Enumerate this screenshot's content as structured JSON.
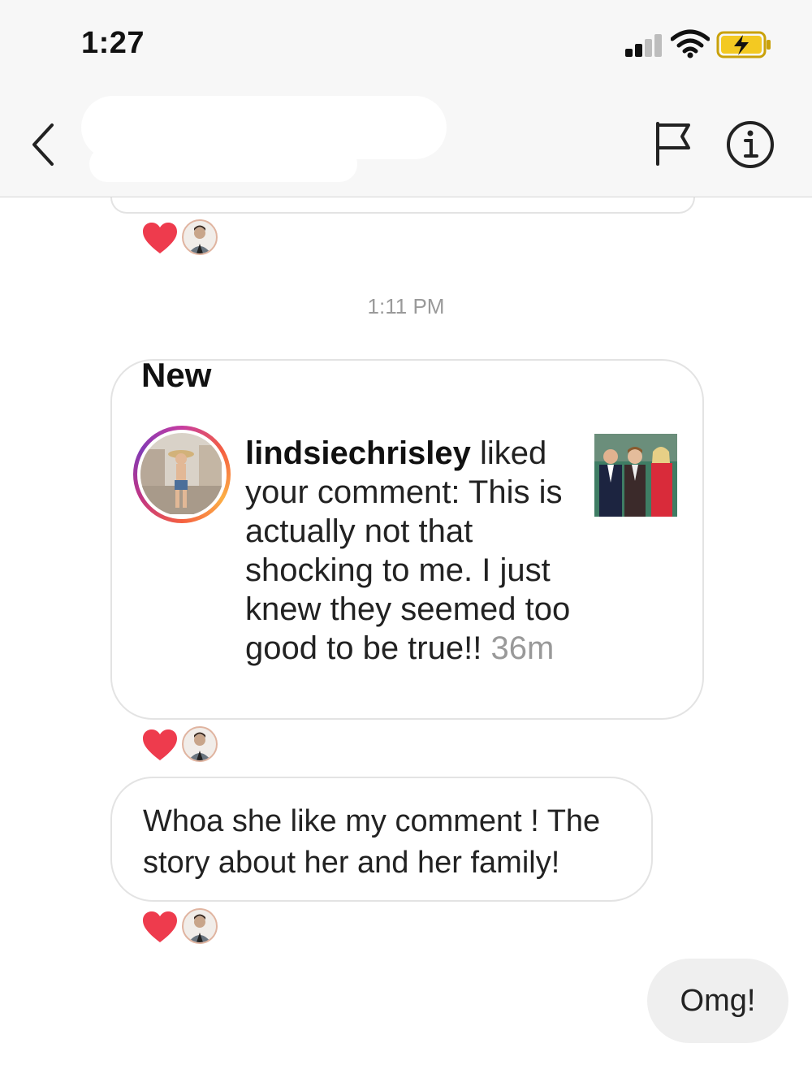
{
  "status_bar": {
    "time": "1:27",
    "signal_icon": "cellular-signal-icon",
    "wifi_icon": "wifi-icon",
    "battery_icon": "battery-charging-icon",
    "battery_color": "#f3c922"
  },
  "header": {
    "back_icon": "chevron-left-icon",
    "report_icon": "flag-icon",
    "details_icon": "info-circle-icon"
  },
  "thread": {
    "timestamp": "1:11 PM",
    "shared_card": {
      "heading": "New",
      "username": "lindsiechrisley",
      "action_text": " liked your comment: This is actually not that shocking to me. I just knew they seemed too good to be true!!",
      "time_ago": "36m"
    },
    "received_message": "Whoa she like my comment ! The story about her and her family!",
    "sent_message": "Omg!",
    "reaction_color": "#ee3b4d"
  }
}
